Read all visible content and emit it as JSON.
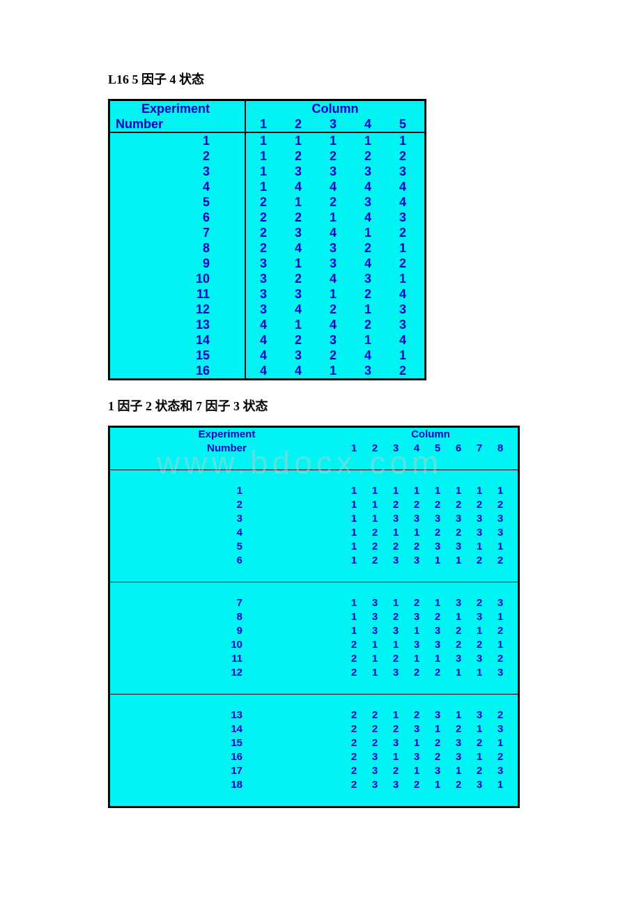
{
  "title1": "L16 5 因子 4 状态",
  "title2": "1 因子 2 状态和 7 因子 3 状态",
  "watermark": "www.bdocx.com",
  "table1": {
    "h_experiment": "Experiment",
    "h_number": "Number",
    "h_column": "Column",
    "cols": [
      "1",
      "2",
      "3",
      "4",
      "5"
    ],
    "rows": [
      {
        "n": "1",
        "v": [
          "1",
          "1",
          "1",
          "1",
          "1"
        ]
      },
      {
        "n": "2",
        "v": [
          "1",
          "2",
          "2",
          "2",
          "2"
        ]
      },
      {
        "n": "3",
        "v": [
          "1",
          "3",
          "3",
          "3",
          "3"
        ]
      },
      {
        "n": "4",
        "v": [
          "1",
          "4",
          "4",
          "4",
          "4"
        ]
      },
      {
        "n": "5",
        "v": [
          "2",
          "1",
          "2",
          "3",
          "4"
        ]
      },
      {
        "n": "6",
        "v": [
          "2",
          "2",
          "1",
          "4",
          "3"
        ]
      },
      {
        "n": "7",
        "v": [
          "2",
          "3",
          "4",
          "1",
          "2"
        ]
      },
      {
        "n": "8",
        "v": [
          "2",
          "4",
          "3",
          "2",
          "1"
        ]
      },
      {
        "n": "9",
        "v": [
          "3",
          "1",
          "3",
          "4",
          "2"
        ]
      },
      {
        "n": "10",
        "v": [
          "3",
          "2",
          "4",
          "3",
          "1"
        ]
      },
      {
        "n": "11",
        "v": [
          "3",
          "3",
          "1",
          "2",
          "4"
        ]
      },
      {
        "n": "12",
        "v": [
          "3",
          "4",
          "2",
          "1",
          "3"
        ]
      },
      {
        "n": "13",
        "v": [
          "4",
          "1",
          "4",
          "2",
          "3"
        ]
      },
      {
        "n": "14",
        "v": [
          "4",
          "2",
          "3",
          "1",
          "4"
        ]
      },
      {
        "n": "15",
        "v": [
          "4",
          "3",
          "2",
          "4",
          "1"
        ]
      },
      {
        "n": "16",
        "v": [
          "4",
          "4",
          "1",
          "3",
          "2"
        ]
      }
    ]
  },
  "table2": {
    "h_experiment": "Experiment",
    "h_number": "Number",
    "h_column": "Column",
    "cols": [
      "1",
      "2",
      "3",
      "4",
      "5",
      "6",
      "7",
      "8"
    ],
    "groups": [
      [
        {
          "n": "1",
          "v": [
            "1",
            "1",
            "1",
            "1",
            "1",
            "1",
            "1",
            "1"
          ]
        },
        {
          "n": "2",
          "v": [
            "1",
            "1",
            "2",
            "2",
            "2",
            "2",
            "2",
            "2"
          ]
        },
        {
          "n": "3",
          "v": [
            "1",
            "1",
            "3",
            "3",
            "3",
            "3",
            "3",
            "3"
          ]
        },
        {
          "n": "4",
          "v": [
            "1",
            "2",
            "1",
            "1",
            "2",
            "2",
            "3",
            "3"
          ]
        },
        {
          "n": "5",
          "v": [
            "1",
            "2",
            "2",
            "2",
            "3",
            "3",
            "1",
            "1"
          ]
        },
        {
          "n": "6",
          "v": [
            "1",
            "2",
            "3",
            "3",
            "1",
            "1",
            "2",
            "2"
          ]
        }
      ],
      [
        {
          "n": "7",
          "v": [
            "1",
            "3",
            "1",
            "2",
            "1",
            "3",
            "2",
            "3"
          ]
        },
        {
          "n": "8",
          "v": [
            "1",
            "3",
            "2",
            "3",
            "2",
            "1",
            "3",
            "1"
          ]
        },
        {
          "n": "9",
          "v": [
            "1",
            "3",
            "3",
            "1",
            "3",
            "2",
            "1",
            "2"
          ]
        },
        {
          "n": "10",
          "v": [
            "2",
            "1",
            "1",
            "3",
            "3",
            "2",
            "2",
            "1"
          ]
        },
        {
          "n": "11",
          "v": [
            "2",
            "1",
            "2",
            "1",
            "1",
            "3",
            "3",
            "2"
          ]
        },
        {
          "n": "12",
          "v": [
            "2",
            "1",
            "3",
            "2",
            "2",
            "1",
            "1",
            "3"
          ]
        }
      ],
      [
        {
          "n": "13",
          "v": [
            "2",
            "2",
            "1",
            "2",
            "3",
            "1",
            "3",
            "2"
          ]
        },
        {
          "n": "14",
          "v": [
            "2",
            "2",
            "2",
            "3",
            "1",
            "2",
            "1",
            "3"
          ]
        },
        {
          "n": "15",
          "v": [
            "2",
            "2",
            "3",
            "1",
            "2",
            "3",
            "2",
            "1"
          ]
        },
        {
          "n": "16",
          "v": [
            "2",
            "3",
            "1",
            "3",
            "2",
            "3",
            "1",
            "2"
          ]
        },
        {
          "n": "17",
          "v": [
            "2",
            "3",
            "2",
            "1",
            "3",
            "1",
            "2",
            "3"
          ]
        },
        {
          "n": "18",
          "v": [
            "2",
            "3",
            "3",
            "2",
            "1",
            "2",
            "3",
            "1"
          ]
        }
      ]
    ]
  },
  "chart_data": [
    {
      "type": "table",
      "title": "L16 5因子4状态 — Orthogonal Array L16(4^5)",
      "columns": [
        "Experiment",
        "1",
        "2",
        "3",
        "4",
        "5"
      ],
      "rows": [
        [
          1,
          1,
          1,
          1,
          1,
          1
        ],
        [
          2,
          1,
          2,
          2,
          2,
          2
        ],
        [
          3,
          1,
          3,
          3,
          3,
          3
        ],
        [
          4,
          1,
          4,
          4,
          4,
          4
        ],
        [
          5,
          2,
          1,
          2,
          3,
          4
        ],
        [
          6,
          2,
          2,
          1,
          4,
          3
        ],
        [
          7,
          2,
          3,
          4,
          1,
          2
        ],
        [
          8,
          2,
          4,
          3,
          2,
          1
        ],
        [
          9,
          3,
          1,
          3,
          4,
          2
        ],
        [
          10,
          3,
          2,
          4,
          3,
          1
        ],
        [
          11,
          3,
          3,
          1,
          2,
          4
        ],
        [
          12,
          3,
          4,
          2,
          1,
          3
        ],
        [
          13,
          4,
          1,
          4,
          2,
          3
        ],
        [
          14,
          4,
          2,
          3,
          1,
          4
        ],
        [
          15,
          4,
          3,
          2,
          4,
          1
        ],
        [
          16,
          4,
          4,
          1,
          3,
          2
        ]
      ]
    },
    {
      "type": "table",
      "title": "1因子2状态和7因子3状态 — L18(2^1 × 3^7)",
      "columns": [
        "Experiment",
        "1",
        "2",
        "3",
        "4",
        "5",
        "6",
        "7",
        "8"
      ],
      "rows": [
        [
          1,
          1,
          1,
          1,
          1,
          1,
          1,
          1,
          1
        ],
        [
          2,
          1,
          1,
          2,
          2,
          2,
          2,
          2,
          2
        ],
        [
          3,
          1,
          1,
          3,
          3,
          3,
          3,
          3,
          3
        ],
        [
          4,
          1,
          2,
          1,
          1,
          2,
          2,
          3,
          3
        ],
        [
          5,
          1,
          2,
          2,
          2,
          3,
          3,
          1,
          1
        ],
        [
          6,
          1,
          2,
          3,
          3,
          1,
          1,
          2,
          2
        ],
        [
          7,
          1,
          3,
          1,
          2,
          1,
          3,
          2,
          3
        ],
        [
          8,
          1,
          3,
          2,
          3,
          2,
          1,
          3,
          1
        ],
        [
          9,
          1,
          3,
          3,
          1,
          3,
          2,
          1,
          2
        ],
        [
          10,
          2,
          1,
          1,
          3,
          3,
          2,
          2,
          1
        ],
        [
          11,
          2,
          1,
          2,
          1,
          1,
          3,
          3,
          2
        ],
        [
          12,
          2,
          1,
          3,
          2,
          2,
          1,
          1,
          3
        ],
        [
          13,
          2,
          2,
          1,
          2,
          3,
          1,
          3,
          2
        ],
        [
          14,
          2,
          2,
          2,
          3,
          1,
          2,
          1,
          3
        ],
        [
          15,
          2,
          2,
          3,
          1,
          2,
          3,
          2,
          1
        ],
        [
          16,
          2,
          3,
          1,
          3,
          2,
          3,
          1,
          2
        ],
        [
          17,
          2,
          3,
          2,
          1,
          3,
          1,
          2,
          3
        ],
        [
          18,
          2,
          3,
          3,
          2,
          1,
          2,
          3,
          1
        ]
      ]
    }
  ]
}
